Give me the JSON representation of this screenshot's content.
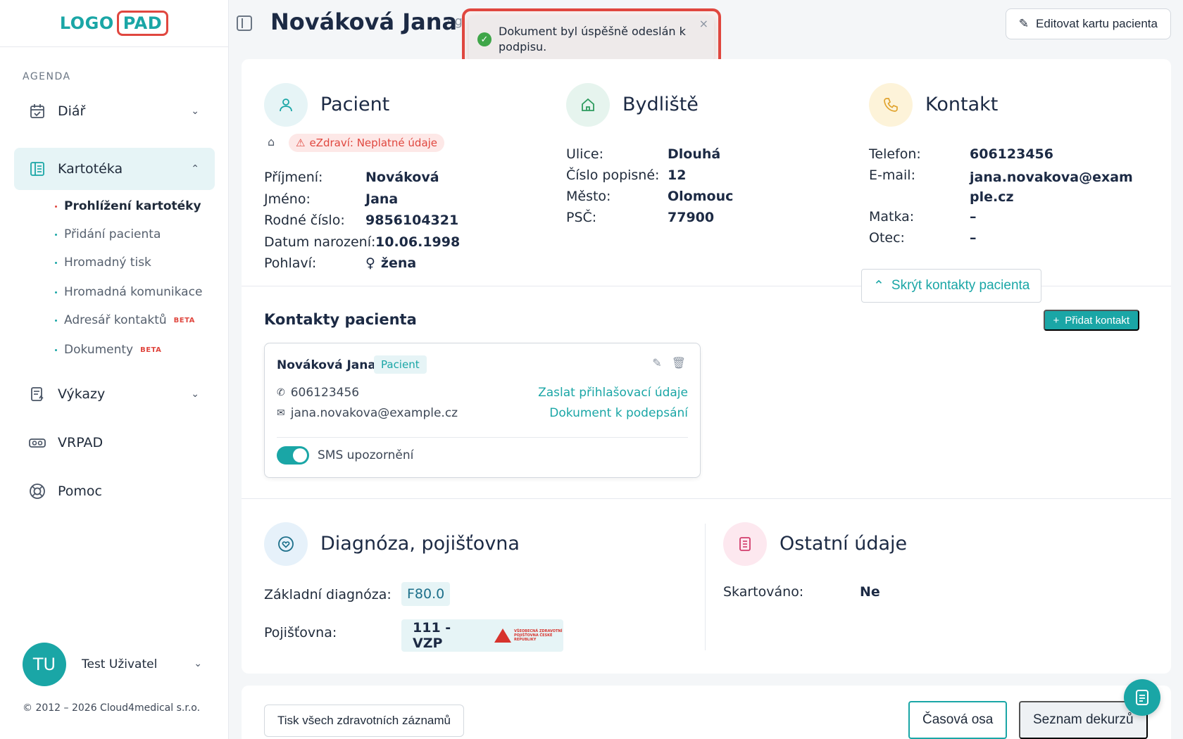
{
  "logo": {
    "part1": "LOGO",
    "part2": "PAD"
  },
  "sidebar": {
    "section_label": "AGENDA",
    "items": [
      {
        "label": "Diář",
        "icon": "calendar-icon"
      },
      {
        "label": "Kartotéka",
        "icon": "file-list-icon"
      },
      {
        "label": "Výkazy",
        "icon": "report-icon"
      },
      {
        "label": "VRPAD",
        "icon": "vr-glasses-icon"
      },
      {
        "label": "Pomoc",
        "icon": "lifebuoy-icon"
      }
    ],
    "sub_items": [
      {
        "label": "Prohlížení kartotéky",
        "badge": ""
      },
      {
        "label": "Přidání pacienta",
        "badge": ""
      },
      {
        "label": "Hromadný tisk",
        "badge": ""
      },
      {
        "label": "Hromadná komunikace",
        "badge": ""
      },
      {
        "label": "Adresář kontaktů",
        "badge": "BETA"
      },
      {
        "label": "Dokumenty",
        "badge": "BETA"
      }
    ],
    "user": {
      "initials": "TU",
      "name": "Test Uživatel"
    },
    "copyright": "© 2012 – 2026 Cloud4medical s.r.o."
  },
  "header": {
    "title": "Nováková Jana",
    "title_suffix": "· g",
    "edit_button": "Editovat kartu pacienta"
  },
  "toast": {
    "message": "Dokument byl úspěšně odeslán k podpisu.",
    "close": "×"
  },
  "patient": {
    "title": "Pacient",
    "warning": "eZdraví: Neplatné údaje",
    "fields": [
      {
        "label": "Příjmení:",
        "value": "Nováková"
      },
      {
        "label": "Jméno:",
        "value": "Jana"
      },
      {
        "label": "Rodné číslo:",
        "value": "9856104321"
      },
      {
        "label": "Datum narození:",
        "value": "10.06.1998"
      },
      {
        "label": "Pohlaví:",
        "value": "žena"
      }
    ]
  },
  "residence": {
    "title": "Bydliště",
    "fields": [
      {
        "label": "Ulice:",
        "value": "Dlouhá"
      },
      {
        "label": "Číslo popisné:",
        "value": "12"
      },
      {
        "label": "Město:",
        "value": "Olomouc"
      },
      {
        "label": "PSČ:",
        "value": "77900"
      }
    ]
  },
  "contact": {
    "title": "Kontakt",
    "fields": [
      {
        "label": "Telefon:",
        "value": "606123456"
      },
      {
        "label": "E-mail:",
        "value": "jana.novakova@example.cz"
      },
      {
        "label": "Matka:",
        "value": "–"
      },
      {
        "label": "Otec:",
        "value": "–"
      }
    ],
    "hide_button": "Skrýt kontakty pacienta"
  },
  "patient_contacts": {
    "title": "Kontakty pacienta",
    "add_button": "Přidat kontakt",
    "card": {
      "name": "Nováková Jana",
      "role": "Pacient",
      "phone": "606123456",
      "email": "jana.novakova@example.cz",
      "send_login": "Zaslat přihlašovací údaje",
      "sign_document": "Dokument k podepsání",
      "sms_label": "SMS upozornění"
    }
  },
  "diagnosis": {
    "title": "Diagnóza, pojišťovna",
    "base_label": "Základní diagnóza:",
    "base_value": "F80.0",
    "insurer_label": "Pojišťovna:",
    "insurer_value": "111 - VZP",
    "insurer_logo_text": "VŠEOBECNÁ ZDRAVOTNÍ POJIŠŤOVNA ČESKÉ REPUBLIKY"
  },
  "other": {
    "title": "Ostatní údaje",
    "shredded_label": "Skartováno:",
    "shredded_value": "Ne"
  },
  "bottom": {
    "print_button": "Tisk všech zdravotních záznamů",
    "tab_timeline": "Časová osa",
    "tab_decursus": "Seznam dekurzů"
  },
  "colors": {
    "accent": "#1aa6a6",
    "danger": "#e0473f",
    "success": "#3fa649"
  }
}
